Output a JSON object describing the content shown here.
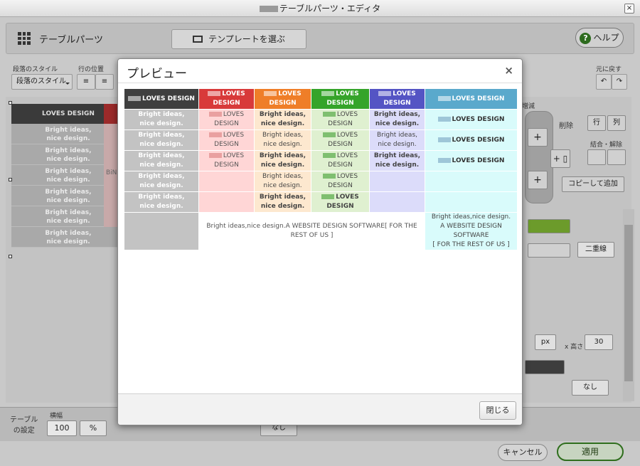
{
  "window": {
    "title": "テーブルパーツ・エディタ",
    "close_label": "×"
  },
  "editor": {
    "title": "テーブルパーツ",
    "template_button": "テンプレートを選ぶ",
    "help_button": "ヘルプ",
    "help_icon": "?",
    "paragraph_style_label": "段落のスタイル",
    "paragraph_style_value": "段落のスタイル",
    "row_position_label": "行の位置",
    "revert_label": "元に戻す",
    "background_table_header": "LOVES DESIGN",
    "background_table_cells": [
      "Bright ideas,\nnice design.",
      "Bright ideas,\nnice design.",
      "Bright ideas,\nnice design.",
      "Bright ideas,\nnice design.",
      "Bright ideas,\nnice design.",
      "Bright ideas,\nnice design."
    ],
    "partial_text": "BiN",
    "right_panel": {
      "decrease_label": "増減",
      "delete_label": "削除",
      "row_label": "行",
      "col_label": "列",
      "merge_label": "結合・解除",
      "copy_add_label": "コピーして追加",
      "border_double": "二重線",
      "unit_px": "px",
      "height_label": "x 高さ",
      "height_value": "30",
      "none_label": "なし"
    },
    "table_settings_label": "テーブル\nの設定",
    "width_label": "横幅",
    "width_value": "100",
    "width_unit": "%",
    "bottom_none": "なし",
    "cancel_button": "キャンセル",
    "apply_button": "適用"
  },
  "modal": {
    "title": "プレビュー",
    "close_icon": "×",
    "close_button": "閉じる",
    "headers": [
      {
        "text": "LOVES DESIGN",
        "bg": "#3f3f3f"
      },
      {
        "text": "LOVES DESIGN",
        "bg": "#d83a3a"
      },
      {
        "text": "LOVES DESIGN",
        "bg": "#ef7e28"
      },
      {
        "text": "LOVES DESIGN",
        "bg": "#35a42a"
      },
      {
        "text": "LOVES DESIGN",
        "bg": "#5454c4"
      },
      {
        "text": "LOVES DESIGN",
        "bg": "#5aa9cc"
      }
    ],
    "rows": [
      [
        "Bright ideas,\nnice design.",
        "LOVES\nDESIGN",
        "Bright ideas,\nnice design.",
        "LOVES\nDESIGN",
        "Bright ideas,\nnice design.",
        "LOVES DESIGN"
      ],
      [
        "Bright ideas,\nnice design.",
        "LOVES\nDESIGN",
        "Bright ideas,\nnice design.",
        "LOVES\nDESIGN",
        "Bright ideas,\nnice design.",
        "LOVES DESIGN"
      ],
      [
        "Bright ideas,\nnice design.",
        "LOVES\nDESIGN",
        "Bright ideas,\nnice design.",
        "LOVES\nDESIGN",
        "Bright ideas,\nnice design.",
        "LOVES DESIGN"
      ],
      [
        "Bright ideas,\nnice design.",
        "",
        "Bright ideas,\nnice design.",
        "LOVES\nDESIGN",
        "",
        ""
      ],
      [
        "Bright ideas,\nnice design.",
        "",
        "Bright ideas,\nnice design.",
        "LOVES\nDESIGN",
        "",
        ""
      ]
    ],
    "footer_merged": "Bright ideas,nice design.A WEBSITE DESIGN SOFTWARE[ FOR THE REST OF US ]",
    "footer_last": "Bright ideas,nice design.\nA WEBSITE DESIGN\nSOFTWARE\n[ FOR THE REST OF US ]"
  }
}
